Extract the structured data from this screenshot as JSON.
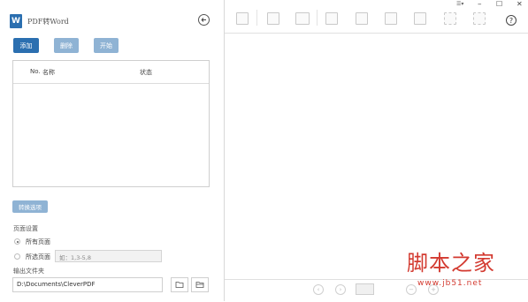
{
  "app": {
    "title": "PDF转Word",
    "logo_letter": "W",
    "back_icon": "back-circle-icon"
  },
  "buttons": {
    "add": "添加",
    "delete": "删除",
    "start": "开始"
  },
  "table": {
    "col_no": "No.",
    "col_name": "名称",
    "col_status": "状态"
  },
  "options": {
    "convert_options_label": "转换选项",
    "page_settings_title": "页面设置",
    "all_pages_label": "所有页面",
    "selected_pages_label": "所选页面",
    "pages_placeholder": "如：1,3-5,8",
    "output_folder_title": "输出文件夹",
    "output_path": "D:\\Documents\\CleverPDF"
  },
  "window": {
    "menu_glyph": "☰▾",
    "minimize": "–",
    "maximize": "☐",
    "close": "✕",
    "help": "?"
  },
  "watermark": {
    "text": "脚本之家",
    "url": "www.jb51.net"
  },
  "colors": {
    "primary": "#2b6fb0",
    "primary_disabled": "#8fb3d4",
    "watermark_red": "#d33a30"
  }
}
